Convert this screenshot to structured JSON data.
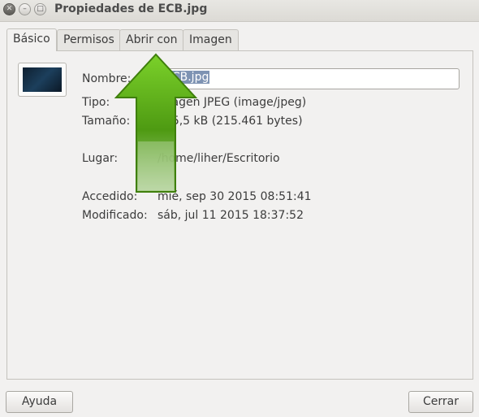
{
  "window": {
    "title": "Propiedades de ECB.jpg"
  },
  "tabs": [
    {
      "label": "Básico"
    },
    {
      "label": "Permisos"
    },
    {
      "label": "Abrir con"
    },
    {
      "label": "Imagen"
    }
  ],
  "basic": {
    "name_label": "Nombre:",
    "name_value": "ECB.jpg",
    "type_label": "Tipo:",
    "type_value": "imagen JPEG (image/jpeg)",
    "size_label": "Tamaño:",
    "size_value": "215,5 kB (215.461 bytes)",
    "location_label": "Lugar:",
    "location_value": "/home/liher/Escritorio",
    "accessed_label": "Accedido:",
    "accessed_value": "mié, sep 30 2015 08:51:41",
    "modified_label": "Modificado:",
    "modified_value": "sáb, jul 11 2015 18:37:52"
  },
  "buttons": {
    "help": "Ayuda",
    "close": "Cerrar"
  },
  "colors": {
    "arrow_green": "#5fb31a",
    "selection": "#7e93b3"
  },
  "icons": {
    "close": "close-icon",
    "minimize": "minimize-icon",
    "maximize": "maximize-icon",
    "arrow": "up-arrow-icon"
  }
}
